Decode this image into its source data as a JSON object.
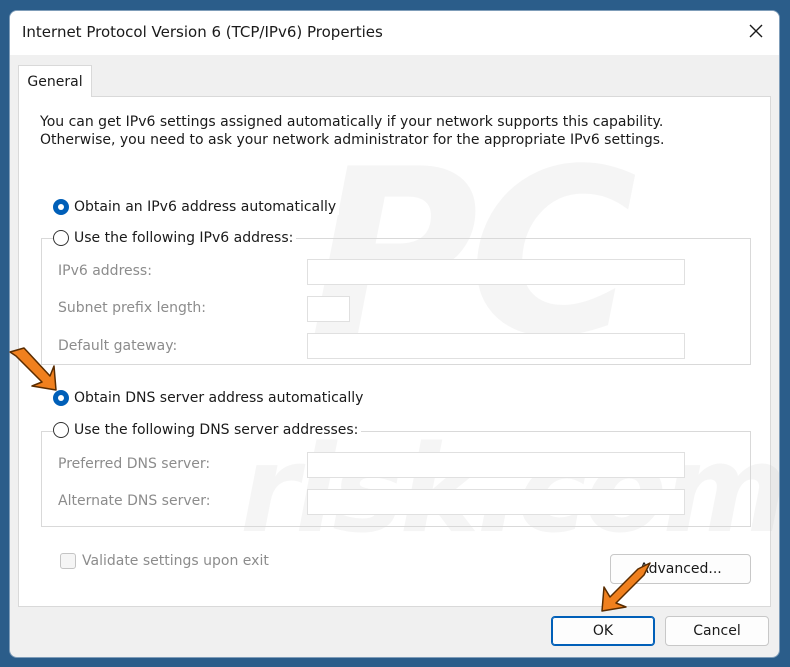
{
  "window": {
    "title": "Internet Protocol Version 6 (TCP/IPv6) Properties"
  },
  "tabs": [
    {
      "label": "General",
      "selected": true
    }
  ],
  "description": {
    "line1": "You can get IPv6 settings assigned automatically if your network supports this capability.",
    "line2": "Otherwise, you need to ask your network administrator for the appropriate IPv6 settings."
  },
  "address": {
    "auto_label": "Obtain an IPv6 address automatically",
    "auto_selected": true,
    "manual_label": "Use the following IPv6 address:",
    "manual_selected": false,
    "fields": [
      {
        "label": "IPv6 address:",
        "value": ""
      },
      {
        "label": "Subnet prefix length:",
        "value": ""
      },
      {
        "label": "Default gateway:",
        "value": ""
      }
    ]
  },
  "dns": {
    "auto_label": "Obtain DNS server address automatically",
    "auto_selected": true,
    "manual_label": "Use the following DNS server addresses:",
    "manual_selected": false,
    "fields": [
      {
        "label": "Preferred DNS server:",
        "value": ""
      },
      {
        "label": "Alternate DNS server:",
        "value": ""
      }
    ]
  },
  "validate": {
    "label": "Validate settings upon exit",
    "checked": false,
    "enabled": false
  },
  "buttons": {
    "advanced": "Advanced...",
    "ok": "OK",
    "cancel": "Cancel"
  },
  "icons": {
    "close": "close-icon",
    "pointer_arrow": "arrow-pointer-icon"
  },
  "colors": {
    "accent": "#005fb8",
    "arrow": "#f0801e",
    "disabled_text": "#8c8c8c"
  }
}
